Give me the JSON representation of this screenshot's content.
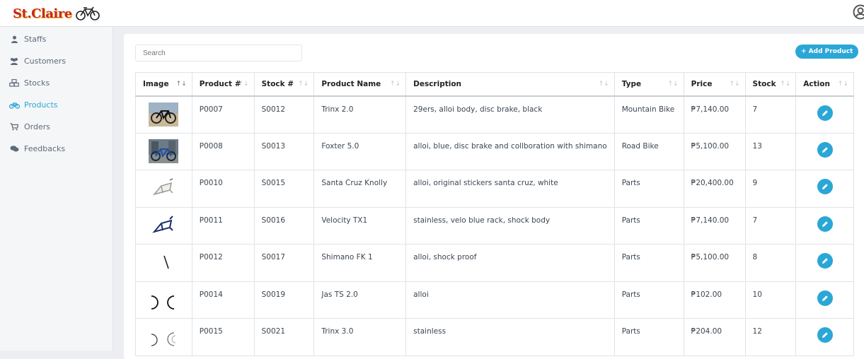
{
  "brand": {
    "name": "St.Claire",
    "accent": "#2aa7d6"
  },
  "sidebar": {
    "items": [
      {
        "label": "Staffs",
        "icon": "user-icon",
        "active": false
      },
      {
        "label": "Customers",
        "icon": "users-icon",
        "active": false
      },
      {
        "label": "Stocks",
        "icon": "boxes-icon",
        "active": false
      },
      {
        "label": "Products",
        "icon": "bicycle-icon",
        "active": true
      },
      {
        "label": "Orders",
        "icon": "cart-icon",
        "active": false
      },
      {
        "label": "Feedbacks",
        "icon": "comments-icon",
        "active": false
      }
    ]
  },
  "toolbar": {
    "search_placeholder": "Search",
    "add_label": "+ Add Product"
  },
  "table": {
    "headers": [
      "Image",
      "Product #",
      "Stock #",
      "Product Name",
      "Description",
      "Type",
      "Price",
      "Stock",
      "Action"
    ],
    "rows": [
      {
        "image": "mountain-bike-photo",
        "product_no": "P0007",
        "stock_no": "S0012",
        "name": "Trinx 2.0",
        "description": "29ers, alloi body, disc brake, black",
        "type": "Mountain Bike",
        "price": "₱7,140.00",
        "stock": "7"
      },
      {
        "image": "road-bike-photo",
        "product_no": "P0008",
        "stock_no": "S0013",
        "name": "Foxter 5.0",
        "description": "alloi, blue, disc brake and collboration with shimano",
        "type": "Road Bike",
        "price": "₱5,100.00",
        "stock": "13"
      },
      {
        "image": "white-frame-photo",
        "product_no": "P0010",
        "stock_no": "S0015",
        "name": "Santa Cruz Knolly",
        "description": "alloi, original stickers santa cruz, white",
        "type": "Parts",
        "price": "₱20,400.00",
        "stock": "9"
      },
      {
        "image": "blue-frame-photo",
        "product_no": "P0011",
        "stock_no": "S0016",
        "name": "Velocity TX1",
        "description": "stainless, velo blue rack, shock body",
        "type": "Parts",
        "price": "₱7,140.00",
        "stock": "7"
      },
      {
        "image": "fork-photo",
        "product_no": "P0012",
        "stock_no": "S0017",
        "name": "Shimano FK 1",
        "description": "alloi, shock proof",
        "type": "Parts",
        "price": "₱5,100.00",
        "stock": "8"
      },
      {
        "image": "rims-photo",
        "product_no": "P0014",
        "stock_no": "S0019",
        "name": "Jas TS 2.0",
        "description": "alloi",
        "type": "Parts",
        "price": "₱102.00",
        "stock": "10"
      },
      {
        "image": "rims-light-photo",
        "product_no": "P0015",
        "stock_no": "S0021",
        "name": "Trinx 3.0",
        "description": "stainless",
        "type": "Parts",
        "price": "₱204.00",
        "stock": "12"
      }
    ]
  }
}
